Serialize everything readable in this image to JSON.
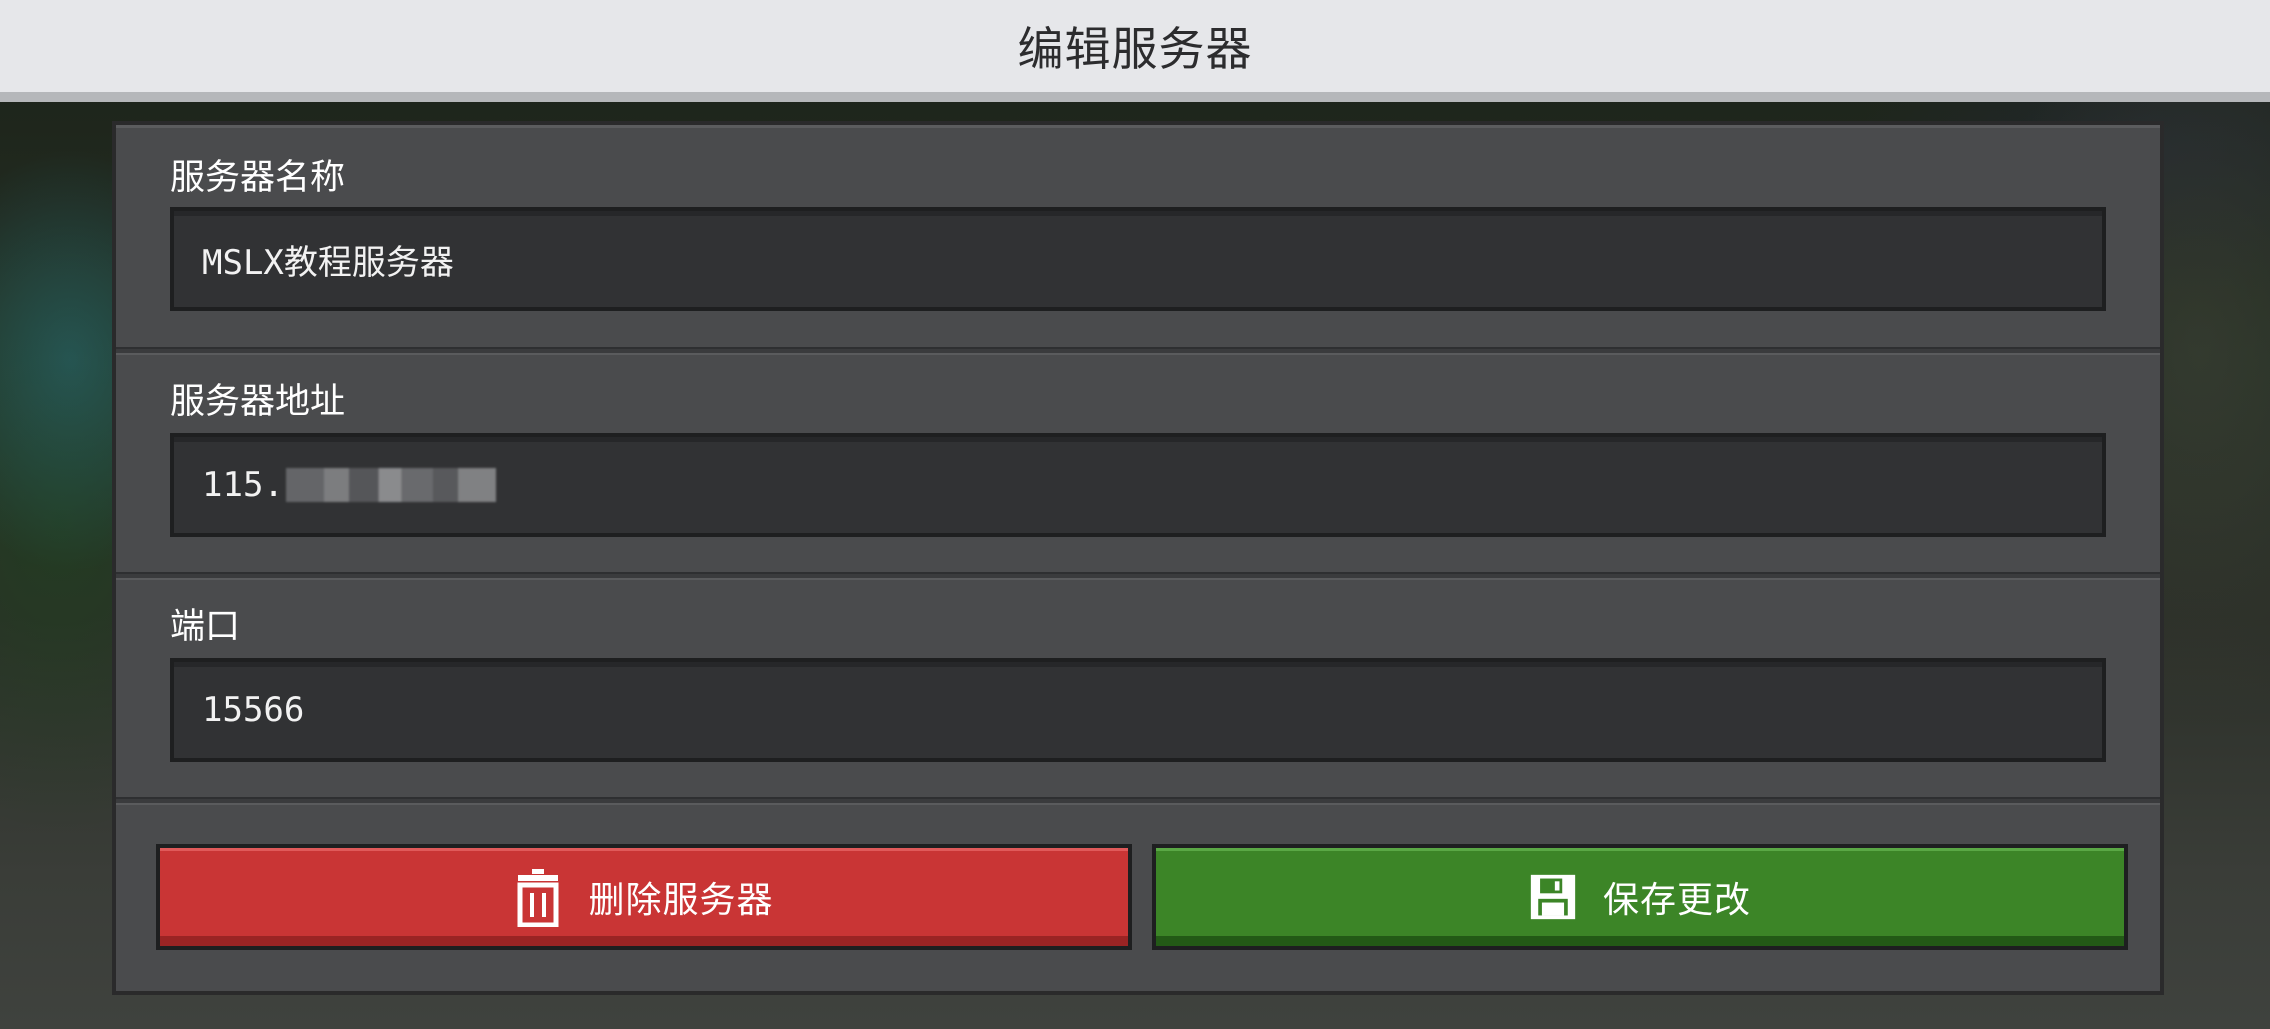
{
  "header": {
    "title": "编辑服务器"
  },
  "form": {
    "server_name": {
      "label": "服务器名称",
      "value": "MSLX教程服务器"
    },
    "server_address": {
      "label": "服务器地址",
      "value_visible": "115."
    },
    "port": {
      "label": "端口",
      "value": "15566"
    }
  },
  "actions": {
    "delete_label": "删除服务器",
    "delete_icon": "trash-icon",
    "save_label": "保存更改",
    "save_icon": "floppy-disk-icon"
  },
  "colors": {
    "delete_button": "#c93535",
    "save_button": "#3c8527",
    "panel": "#4a4b4d",
    "input": "#313234",
    "title_bar": "#e6e7ea"
  }
}
